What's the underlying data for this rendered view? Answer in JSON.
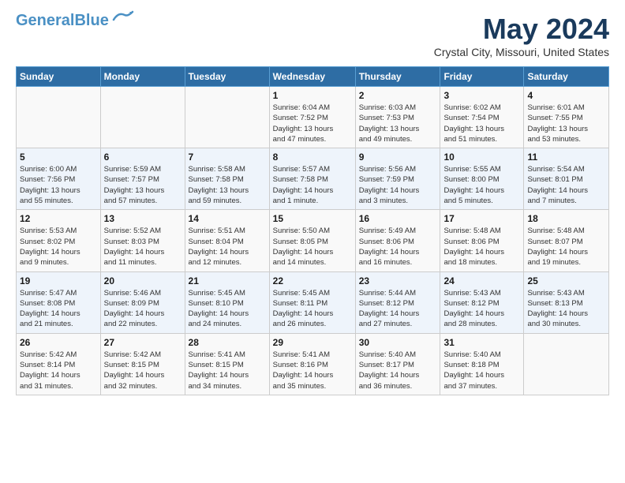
{
  "logo": {
    "line1": "General",
    "line2": "Blue"
  },
  "title": "May 2024",
  "location": "Crystal City, Missouri, United States",
  "days_of_week": [
    "Sunday",
    "Monday",
    "Tuesday",
    "Wednesday",
    "Thursday",
    "Friday",
    "Saturday"
  ],
  "weeks": [
    [
      {
        "day": "",
        "info": ""
      },
      {
        "day": "",
        "info": ""
      },
      {
        "day": "",
        "info": ""
      },
      {
        "day": "1",
        "info": "Sunrise: 6:04 AM\nSunset: 7:52 PM\nDaylight: 13 hours\nand 47 minutes."
      },
      {
        "day": "2",
        "info": "Sunrise: 6:03 AM\nSunset: 7:53 PM\nDaylight: 13 hours\nand 49 minutes."
      },
      {
        "day": "3",
        "info": "Sunrise: 6:02 AM\nSunset: 7:54 PM\nDaylight: 13 hours\nand 51 minutes."
      },
      {
        "day": "4",
        "info": "Sunrise: 6:01 AM\nSunset: 7:55 PM\nDaylight: 13 hours\nand 53 minutes."
      }
    ],
    [
      {
        "day": "5",
        "info": "Sunrise: 6:00 AM\nSunset: 7:56 PM\nDaylight: 13 hours\nand 55 minutes."
      },
      {
        "day": "6",
        "info": "Sunrise: 5:59 AM\nSunset: 7:57 PM\nDaylight: 13 hours\nand 57 minutes."
      },
      {
        "day": "7",
        "info": "Sunrise: 5:58 AM\nSunset: 7:58 PM\nDaylight: 13 hours\nand 59 minutes."
      },
      {
        "day": "8",
        "info": "Sunrise: 5:57 AM\nSunset: 7:58 PM\nDaylight: 14 hours\nand 1 minute."
      },
      {
        "day": "9",
        "info": "Sunrise: 5:56 AM\nSunset: 7:59 PM\nDaylight: 14 hours\nand 3 minutes."
      },
      {
        "day": "10",
        "info": "Sunrise: 5:55 AM\nSunset: 8:00 PM\nDaylight: 14 hours\nand 5 minutes."
      },
      {
        "day": "11",
        "info": "Sunrise: 5:54 AM\nSunset: 8:01 PM\nDaylight: 14 hours\nand 7 minutes."
      }
    ],
    [
      {
        "day": "12",
        "info": "Sunrise: 5:53 AM\nSunset: 8:02 PM\nDaylight: 14 hours\nand 9 minutes."
      },
      {
        "day": "13",
        "info": "Sunrise: 5:52 AM\nSunset: 8:03 PM\nDaylight: 14 hours\nand 11 minutes."
      },
      {
        "day": "14",
        "info": "Sunrise: 5:51 AM\nSunset: 8:04 PM\nDaylight: 14 hours\nand 12 minutes."
      },
      {
        "day": "15",
        "info": "Sunrise: 5:50 AM\nSunset: 8:05 PM\nDaylight: 14 hours\nand 14 minutes."
      },
      {
        "day": "16",
        "info": "Sunrise: 5:49 AM\nSunset: 8:06 PM\nDaylight: 14 hours\nand 16 minutes."
      },
      {
        "day": "17",
        "info": "Sunrise: 5:48 AM\nSunset: 8:06 PM\nDaylight: 14 hours\nand 18 minutes."
      },
      {
        "day": "18",
        "info": "Sunrise: 5:48 AM\nSunset: 8:07 PM\nDaylight: 14 hours\nand 19 minutes."
      }
    ],
    [
      {
        "day": "19",
        "info": "Sunrise: 5:47 AM\nSunset: 8:08 PM\nDaylight: 14 hours\nand 21 minutes."
      },
      {
        "day": "20",
        "info": "Sunrise: 5:46 AM\nSunset: 8:09 PM\nDaylight: 14 hours\nand 22 minutes."
      },
      {
        "day": "21",
        "info": "Sunrise: 5:45 AM\nSunset: 8:10 PM\nDaylight: 14 hours\nand 24 minutes."
      },
      {
        "day": "22",
        "info": "Sunrise: 5:45 AM\nSunset: 8:11 PM\nDaylight: 14 hours\nand 26 minutes."
      },
      {
        "day": "23",
        "info": "Sunrise: 5:44 AM\nSunset: 8:12 PM\nDaylight: 14 hours\nand 27 minutes."
      },
      {
        "day": "24",
        "info": "Sunrise: 5:43 AM\nSunset: 8:12 PM\nDaylight: 14 hours\nand 28 minutes."
      },
      {
        "day": "25",
        "info": "Sunrise: 5:43 AM\nSunset: 8:13 PM\nDaylight: 14 hours\nand 30 minutes."
      }
    ],
    [
      {
        "day": "26",
        "info": "Sunrise: 5:42 AM\nSunset: 8:14 PM\nDaylight: 14 hours\nand 31 minutes."
      },
      {
        "day": "27",
        "info": "Sunrise: 5:42 AM\nSunset: 8:15 PM\nDaylight: 14 hours\nand 32 minutes."
      },
      {
        "day": "28",
        "info": "Sunrise: 5:41 AM\nSunset: 8:15 PM\nDaylight: 14 hours\nand 34 minutes."
      },
      {
        "day": "29",
        "info": "Sunrise: 5:41 AM\nSunset: 8:16 PM\nDaylight: 14 hours\nand 35 minutes."
      },
      {
        "day": "30",
        "info": "Sunrise: 5:40 AM\nSunset: 8:17 PM\nDaylight: 14 hours\nand 36 minutes."
      },
      {
        "day": "31",
        "info": "Sunrise: 5:40 AM\nSunset: 8:18 PM\nDaylight: 14 hours\nand 37 minutes."
      },
      {
        "day": "",
        "info": ""
      }
    ]
  ]
}
